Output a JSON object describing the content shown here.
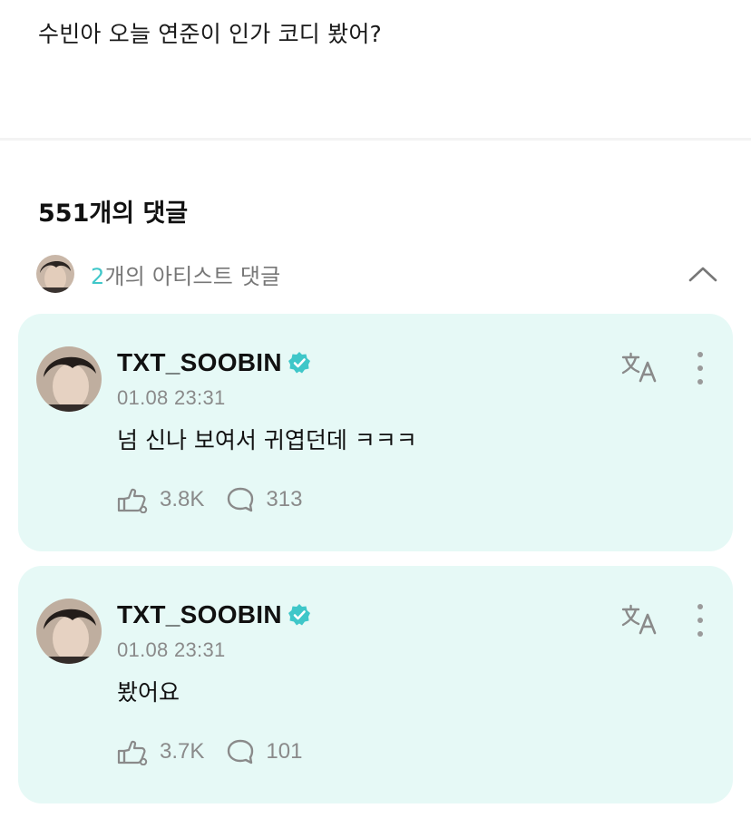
{
  "post": {
    "text": "수빈아 오늘 연준이 인가 코디 봤어?"
  },
  "comments_header": {
    "count_label": "551개의 댓글"
  },
  "artist_comments": {
    "count": "2",
    "label_suffix": "개의 아티스트 댓글",
    "collapse_icon": "chevron-up-icon"
  },
  "comments": [
    {
      "author": "TXT_SOOBIN",
      "verified": true,
      "time": "01.08 23:31",
      "text": "넘 신나 보여서 귀엽던데 ㅋㅋㅋ",
      "likes": "3.8K",
      "replies": "313"
    },
    {
      "author": "TXT_SOOBIN",
      "verified": true,
      "time": "01.08 23:31",
      "text": "봤어요",
      "likes": "3.7K",
      "replies": "101"
    }
  ],
  "colors": {
    "card_bg": "#e6f9f6",
    "accent": "#3fc7c9",
    "muted": "#8a8a8a"
  }
}
